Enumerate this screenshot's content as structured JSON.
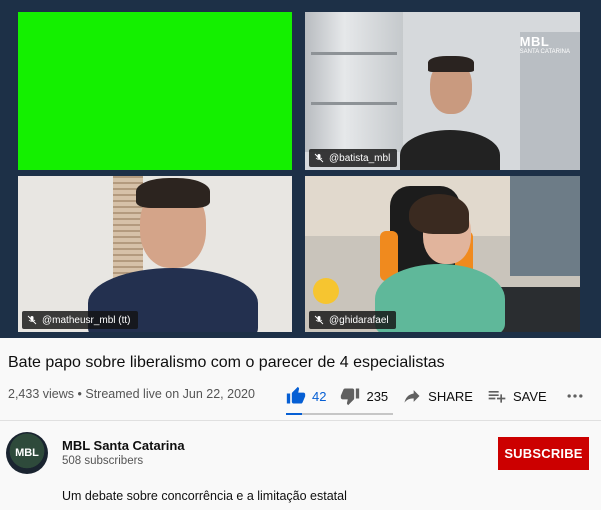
{
  "video": {
    "participants": [
      {
        "tag": "@batista_mbl"
      },
      {
        "tag": "@matheusr_mbl (tt)"
      },
      {
        "tag": "@ghidarafael"
      }
    ],
    "watermark": {
      "main": "MBL",
      "sub": "SANTA CATARINA"
    }
  },
  "title": "Bate papo sobre liberalismo com o parecer de 4 especialistas",
  "meta": {
    "views": "2,433 views",
    "separator": "•",
    "streamed": "Streamed live on Jun 22, 2020"
  },
  "actions": {
    "likes": "42",
    "dislikes": "235",
    "share": "SHARE",
    "save": "SAVE",
    "like_ratio": 0.15
  },
  "channel": {
    "name": "MBL Santa Catarina",
    "subscribers": "508 subscribers",
    "avatar_text": "MBL",
    "subscribe_label": "SUBSCRIBE"
  },
  "description": "Um debate sobre concorrência e a limitação estatal",
  "colors": {
    "accent": "#065fd4",
    "subscribe": "#cc0000",
    "green_screen": "#14f000"
  },
  "icons": [
    "mic-off-icon",
    "thumbs-up-icon",
    "thumbs-down-icon",
    "share-icon",
    "save-playlist-icon",
    "more-icon"
  ]
}
